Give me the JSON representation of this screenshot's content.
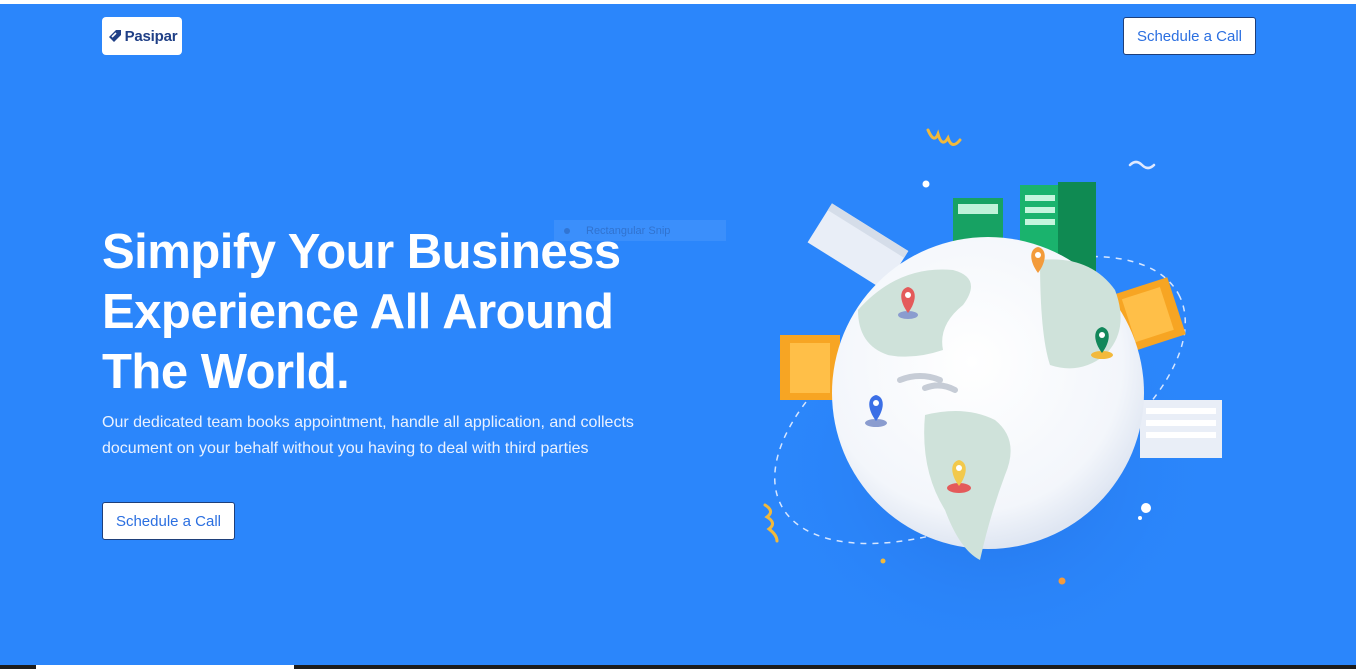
{
  "header": {
    "logo_text": "Pasipar",
    "cta_label": "Schedule a Call"
  },
  "hero": {
    "headline_line1": "Simpify Your Business",
    "headline_line2": "Experience All Around",
    "headline_line3": "The World.",
    "subtext": "Our dedicated team books appointment, handle all application, and collects document on your behalf without you having to deal with third parties",
    "cta_label": "Schedule a Call"
  },
  "overlay": {
    "snip_label": "Rectangular Snip"
  },
  "colors": {
    "background": "#2b86fb",
    "button_text": "#2b6fe0",
    "logo_text": "#1f3f86"
  },
  "icons": [
    "pasipar-logo-icon",
    "map-pin-icon"
  ]
}
